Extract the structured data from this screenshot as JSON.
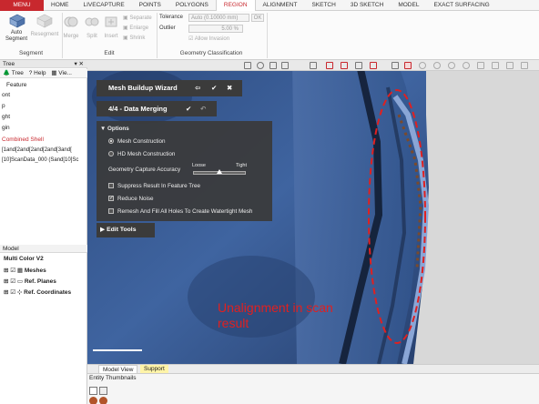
{
  "ribbon_tabs": [
    "MENU",
    "HOME",
    "LIVECAPTURE",
    "POINTS",
    "POLYGONS",
    "REGION",
    "ALIGNMENT",
    "SKETCH",
    "3D SKETCH",
    "MODEL",
    "EXACT SURFACING"
  ],
  "ribbon": {
    "segment": {
      "auto_segment": "Auto Segment",
      "resegment": "Resegment",
      "group_title": "Segment"
    },
    "edit": {
      "merge": "Merge",
      "split": "Split",
      "insert": "Insert",
      "separate": "Separate",
      "enlarge": "Enlarge",
      "shrink": "Shrink",
      "group_title": "Edit"
    },
    "geometry": {
      "tolerance_label": "Tolerance",
      "tolerance_value": "Auto (0.10000 mm)",
      "ok": "OK",
      "outlier_label": "Outlier",
      "outlier_value": "5.00 %",
      "allow_invasion": "Allow Invasion",
      "group_title": "Geometry Classification"
    }
  },
  "tree_panel": {
    "title": "Tree",
    "tools": [
      "Tree",
      "Help",
      "Vie..."
    ],
    "items": [
      "Feature",
      "ont",
      "p",
      "ght",
      "gin"
    ],
    "combined_shell": "Combined Shell",
    "scan_line_1": "[1and[2and[2and[2and[3and[",
    "scan_line_2": "[10]ScanData_000 (Sand[10]Sc"
  },
  "model_panel": {
    "title": "Model",
    "root": "Multi Color V2",
    "items": [
      "Meshes",
      "Ref. Planes",
      "Ref. Coordinates"
    ]
  },
  "wizard": {
    "title": "Mesh Buildup Wizard",
    "step": "4/4 - Data Merging",
    "options_title": "Options",
    "radio_mesh": "Mesh Construction",
    "radio_hd": "HD Mesh Construction",
    "accuracy_label": "Geometry Capture Accuracy",
    "accuracy_low": "Loose",
    "accuracy_high": "Tight",
    "accuracy_level": 0.5,
    "check_suppress": "Suppress Result In Feature Tree",
    "check_noise": "Reduce Noise",
    "check_remesh": "Remesh And Fill All Holes To Create Watertight Mesh",
    "edit_tools": "Edit Tools"
  },
  "annotation": {
    "line1": "Unalignment in scan",
    "line2": "result",
    "color": "#e02020"
  },
  "bottom_tabs": [
    "Model View",
    "Support"
  ],
  "thumbnails_label": "Entity Thumbnails",
  "colors": {
    "menu": "#c8282e",
    "active_tab": "#c8282e",
    "mesh": "#3d5f94",
    "support_tab": "#fff4a8"
  }
}
